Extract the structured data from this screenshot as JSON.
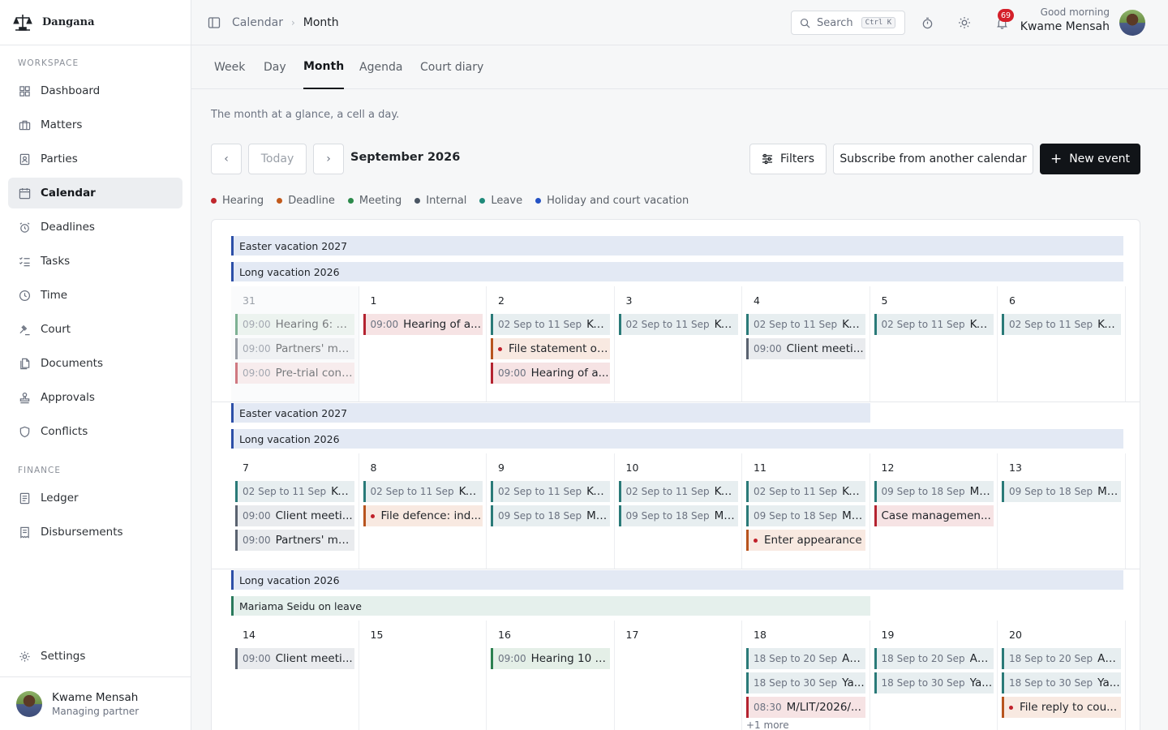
{
  "brand": {
    "name": "Dangana"
  },
  "sidebar": {
    "workspace_label": "WORKSPACE",
    "finance_label": "FINANCE",
    "items": [
      {
        "label": "Dashboard",
        "icon": "dashboard-icon"
      },
      {
        "label": "Matters",
        "icon": "briefcase-icon"
      },
      {
        "label": "Parties",
        "icon": "contact-card-icon"
      },
      {
        "label": "Calendar",
        "icon": "calendar-icon",
        "active": true
      },
      {
        "label": "Deadlines",
        "icon": "alarm-clock-icon"
      },
      {
        "label": "Tasks",
        "icon": "checklist-icon"
      },
      {
        "label": "Time",
        "icon": "clock-icon"
      },
      {
        "label": "Court",
        "icon": "gavel-icon"
      },
      {
        "label": "Documents",
        "icon": "documents-icon"
      },
      {
        "label": "Approvals",
        "icon": "stamp-icon"
      },
      {
        "label": "Conflicts",
        "icon": "shield-icon"
      }
    ],
    "finance_items": [
      {
        "label": "Ledger",
        "icon": "ledger-icon"
      },
      {
        "label": "Disbursements",
        "icon": "receipt-icon"
      }
    ],
    "settings_label": "Settings",
    "user": {
      "name": "Kwame Mensah",
      "role": "Managing partner"
    }
  },
  "header": {
    "breadcrumb_root": "Calendar",
    "breadcrumb_current": "Month",
    "search_label": "Search",
    "search_shortcut": "Ctrl K",
    "notification_count": "69",
    "greeting": "Good morning",
    "user_name": "Kwame Mensah"
  },
  "tabs": [
    "Week",
    "Day",
    "Month",
    "Agenda",
    "Court diary"
  ],
  "subtitle": "The month at a glance, a cell a day.",
  "toolbar": {
    "today_label": "Today",
    "month_label": "September 2026",
    "filters_label": "Filters",
    "subscribe_label": "Subscribe from another calendar",
    "new_event_label": "New event"
  },
  "legend": [
    {
      "label": "Hearing",
      "color": "#c0272d"
    },
    {
      "label": "Deadline",
      "color": "#c25a1c"
    },
    {
      "label": "Meeting",
      "color": "#2c8a4b"
    },
    {
      "label": "Internal",
      "color": "#4a5563"
    },
    {
      "label": "Leave",
      "color": "#1f8a7a"
    },
    {
      "label": "Holiday and court vacation",
      "color": "#2452c4"
    }
  ],
  "weeks": [
    {
      "bands": [
        {
          "label": "Easter vacation 2027",
          "kind": "holiday",
          "from": 0,
          "to": 6
        },
        {
          "label": "Long vacation 2026",
          "kind": "holiday",
          "from": 0,
          "to": 6
        }
      ],
      "days": [
        {
          "num": "31",
          "outside": true,
          "events": [
            {
              "time": "09:00",
              "title": "Hearing 6: m...",
              "kind": "meeting",
              "faded": true
            },
            {
              "time": "09:00",
              "title": "Partners' me...",
              "kind": "internal",
              "faded": true
            },
            {
              "time": "09:00",
              "title": "Pre-trial conf...",
              "kind": "hearing",
              "faded": true
            }
          ]
        },
        {
          "num": "1",
          "events": [
            {
              "time": "09:00",
              "title": "Hearing of a...",
              "kind": "hearing"
            }
          ]
        },
        {
          "num": "2",
          "events": [
            {
              "time": "02 Sep to 11 Sep",
              "title": "Koj...",
              "kind": "leave"
            },
            {
              "title": "File statement of...",
              "kind": "deadline",
              "bullet": true
            },
            {
              "time": "09:00",
              "title": "Hearing of a...",
              "kind": "hearing"
            }
          ]
        },
        {
          "num": "3",
          "events": [
            {
              "time": "02 Sep to 11 Sep",
              "title": "Koj...",
              "kind": "leave"
            }
          ]
        },
        {
          "num": "4",
          "events": [
            {
              "time": "02 Sep to 11 Sep",
              "title": "Koj...",
              "kind": "leave"
            },
            {
              "time": "09:00",
              "title": "Client meeti...",
              "kind": "internal"
            }
          ]
        },
        {
          "num": "5",
          "events": [
            {
              "time": "02 Sep to 11 Sep",
              "title": "Koj...",
              "kind": "leave"
            }
          ]
        },
        {
          "num": "6",
          "events": [
            {
              "time": "02 Sep to 11 Sep",
              "title": "Koj...",
              "kind": "leave"
            }
          ]
        }
      ]
    },
    {
      "bands": [
        {
          "label": "Easter vacation 2027",
          "kind": "holiday",
          "from": 0,
          "to": 4
        },
        {
          "label": "Long vacation 2026",
          "kind": "holiday",
          "from": 0,
          "to": 6
        }
      ],
      "days": [
        {
          "num": "7",
          "events": [
            {
              "time": "02 Sep to 11 Sep",
              "title": "Koj...",
              "kind": "leave"
            },
            {
              "time": "09:00",
              "title": "Client meeti...",
              "kind": "internal"
            },
            {
              "time": "09:00",
              "title": "Partners' me...",
              "kind": "internal"
            }
          ]
        },
        {
          "num": "8",
          "events": [
            {
              "time": "02 Sep to 11 Sep",
              "title": "Koj...",
              "kind": "leave"
            },
            {
              "title": "File defence: ind...",
              "kind": "deadline",
              "bullet": true
            }
          ]
        },
        {
          "num": "9",
          "events": [
            {
              "time": "02 Sep to 11 Sep",
              "title": "Koj...",
              "kind": "leave"
            },
            {
              "time": "09 Sep to 18 Sep",
              "title": "Ma...",
              "kind": "leave"
            }
          ]
        },
        {
          "num": "10",
          "events": [
            {
              "time": "02 Sep to 11 Sep",
              "title": "Koj...",
              "kind": "leave"
            },
            {
              "time": "09 Sep to 18 Sep",
              "title": "Ma...",
              "kind": "leave"
            }
          ]
        },
        {
          "num": "11",
          "events": [
            {
              "time": "02 Sep to 11 Sep",
              "title": "Koj...",
              "kind": "leave"
            },
            {
              "time": "09 Sep to 18 Sep",
              "title": "Ma...",
              "kind": "leave"
            },
            {
              "title": "Enter appearance",
              "kind": "deadline",
              "bullet": true
            }
          ]
        },
        {
          "num": "12",
          "events": [
            {
              "time": "09 Sep to 18 Sep",
              "title": "Ma...",
              "kind": "leave"
            },
            {
              "title": "Case managemen...",
              "kind": "hearing"
            }
          ]
        },
        {
          "num": "13",
          "events": [
            {
              "time": "09 Sep to 18 Sep",
              "title": "Ma...",
              "kind": "leave"
            }
          ]
        }
      ]
    },
    {
      "bands": [
        {
          "label": "Long vacation 2026",
          "kind": "holiday",
          "from": 0,
          "to": 6
        },
        {
          "label": "Mariama Seidu on leave",
          "kind": "leave",
          "from": 0,
          "to": 4
        }
      ],
      "days": [
        {
          "num": "14",
          "events": [
            {
              "time": "09:00",
              "title": "Client meeti...",
              "kind": "internal"
            }
          ]
        },
        {
          "num": "15",
          "events": []
        },
        {
          "num": "16",
          "events": [
            {
              "time": "09:00",
              "title": "Hearing 10 K...",
              "kind": "meeting"
            }
          ]
        },
        {
          "num": "17",
          "events": []
        },
        {
          "num": "18",
          "events": [
            {
              "time": "18 Sep to 20 Sep",
              "title": "Ak...",
              "kind": "leave"
            },
            {
              "time": "18 Sep to 30 Sep",
              "title": "Ya...",
              "kind": "leave"
            },
            {
              "time": "08:30",
              "title": "M/LIT/2026/...",
              "kind": "hearing"
            }
          ],
          "more": "+1 more"
        },
        {
          "num": "19",
          "events": [
            {
              "time": "18 Sep to 20 Sep",
              "title": "Ak...",
              "kind": "leave"
            },
            {
              "time": "18 Sep to 30 Sep",
              "title": "Ya...",
              "kind": "leave"
            }
          ]
        },
        {
          "num": "20",
          "events": [
            {
              "time": "18 Sep to 20 Sep",
              "title": "Ak...",
              "kind": "leave"
            },
            {
              "time": "18 Sep to 30 Sep",
              "title": "Ya...",
              "kind": "leave"
            },
            {
              "title": "File reply to cou...",
              "kind": "deadline",
              "bullet": true
            }
          ]
        }
      ]
    },
    {
      "bands": [
        {
          "label": "Long vacation 2026",
          "kind": "holiday",
          "from": 0,
          "to": 6
        }
      ],
      "days": []
    }
  ]
}
